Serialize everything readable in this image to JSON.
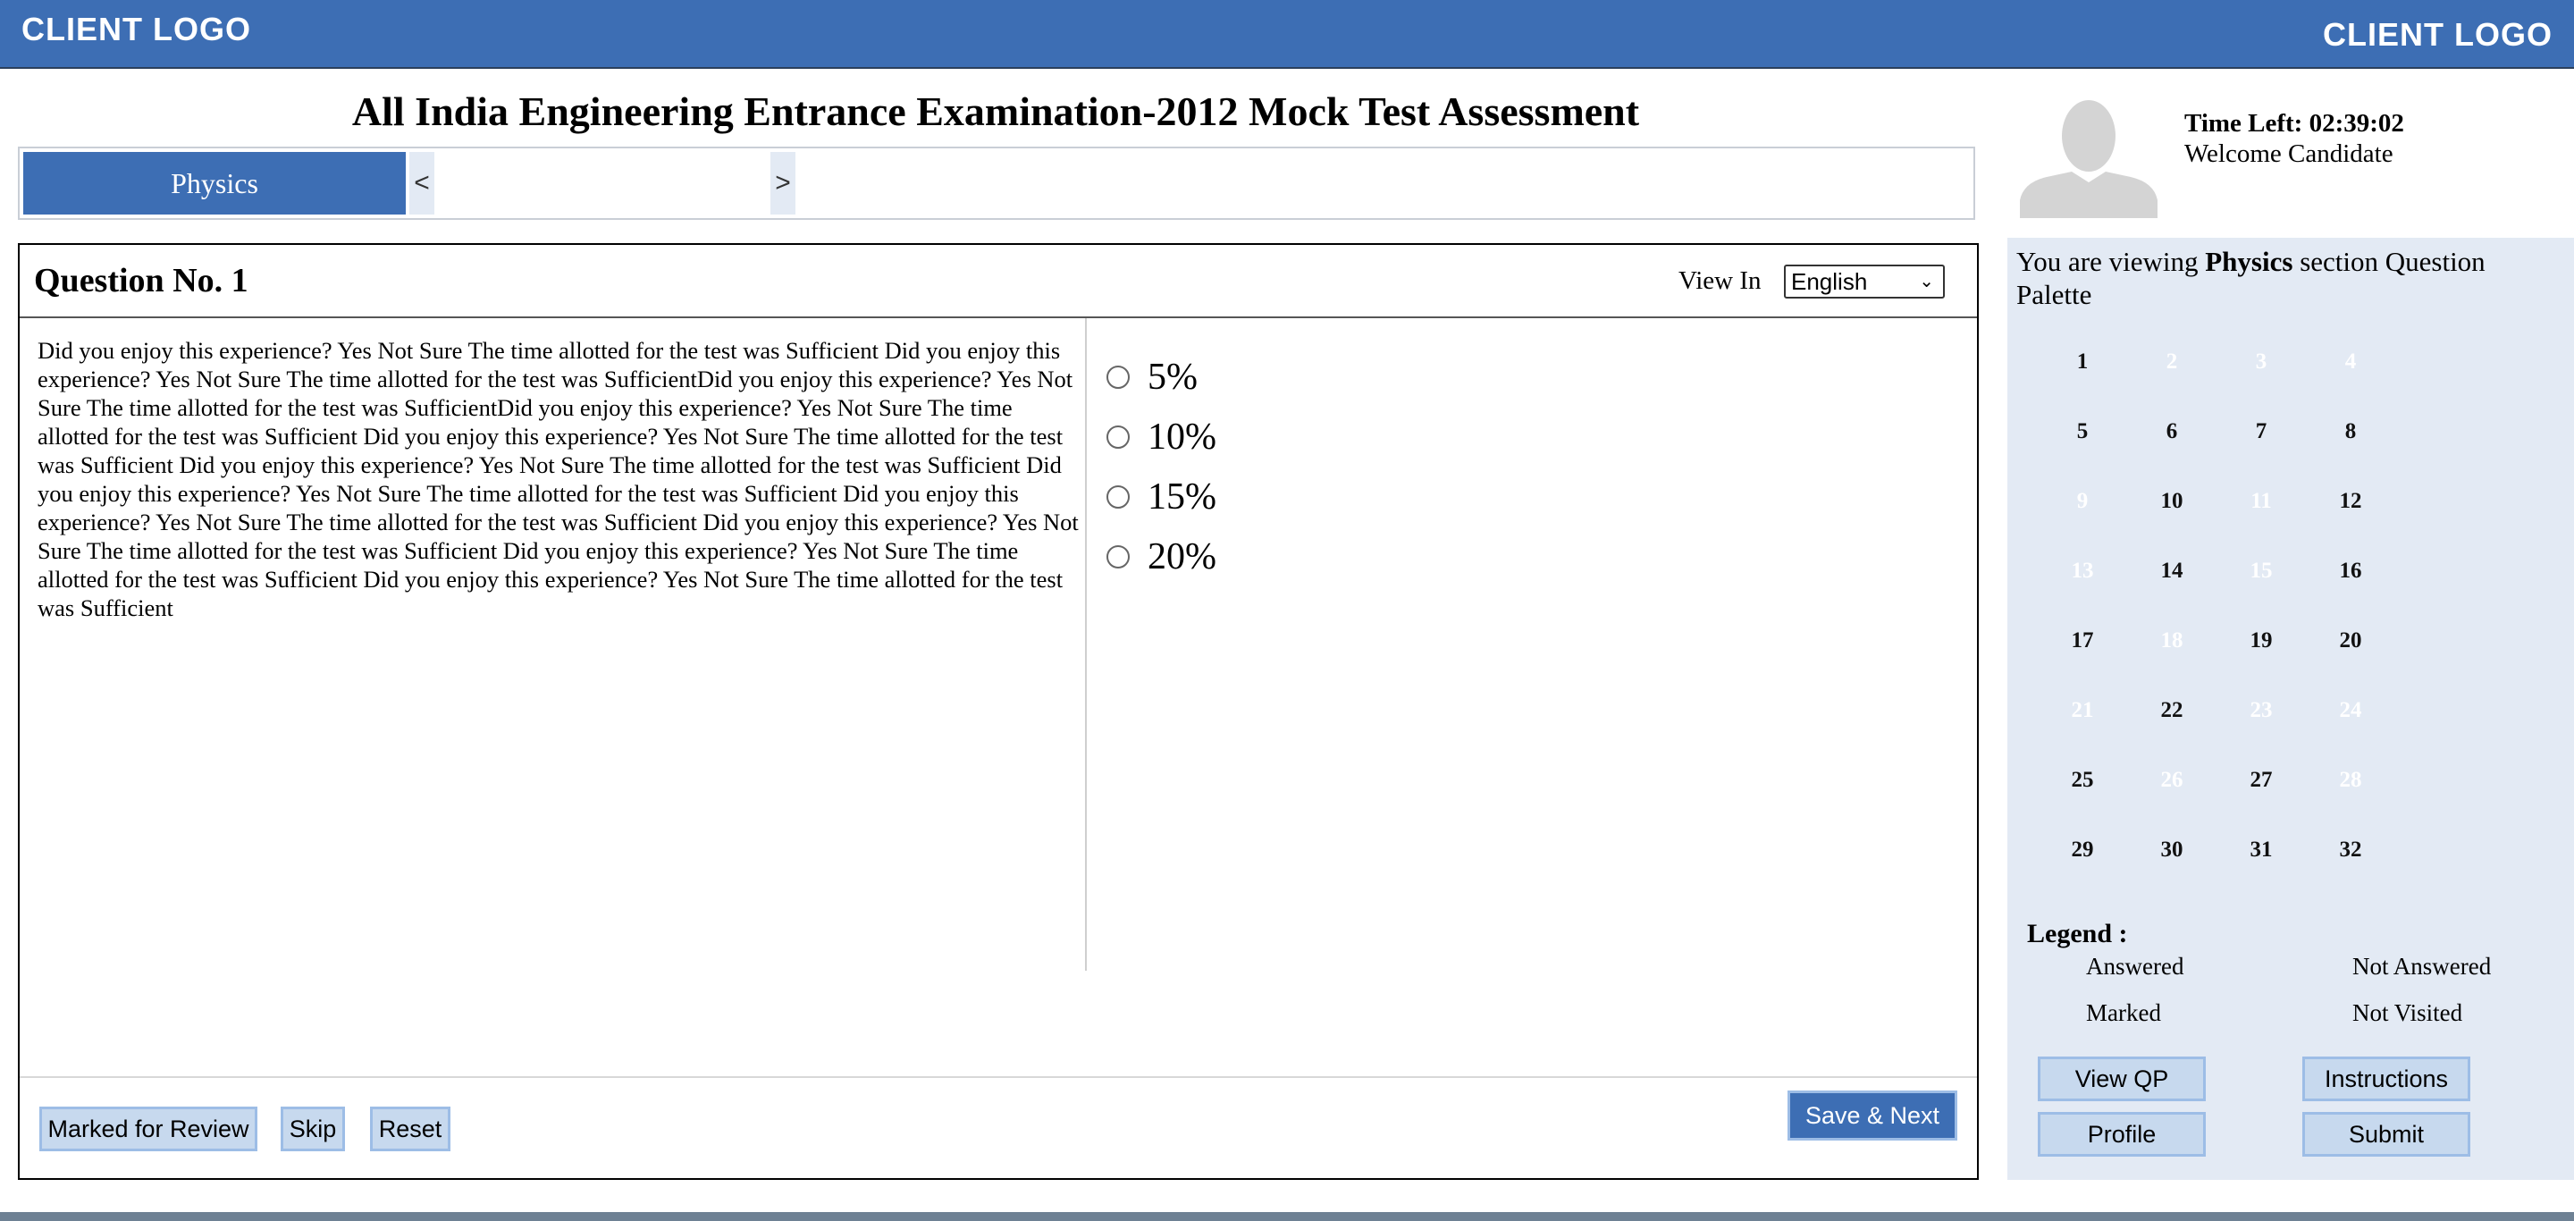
{
  "header": {
    "left_logo": "CLIENT LOGO",
    "right_logo": "CLIENT LOGO",
    "bar_color": "#3d6eb4"
  },
  "exam": {
    "title": "All India Engineering Entrance Examination-2012 Mock Test Assessment"
  },
  "sections": {
    "active": "Physics",
    "prev_arrow": "<",
    "next_arrow": ">"
  },
  "question": {
    "number_label": "Question No. 1",
    "view_in_label": "View In",
    "language": "English",
    "text": "Did you enjoy this experience? Yes Not Sure The time allotted for the test was Sufficient Did you enjoy this experience? Yes Not Sure The time allotted for the test was SufficientDid you enjoy this experience? Yes Not Sure The time allotted for the test was SufficientDid you enjoy this experience? Yes Not Sure The time allotted for the test was Sufficient Did you enjoy this experience? Yes Not Sure The time allotted for the test was Sufficient Did you enjoy this experience? Yes Not Sure The time allotted for the test was Sufficient Did you enjoy this experience? Yes Not Sure The time allotted for the test was Sufficient Did you enjoy this experience? Yes Not Sure The time allotted for the test was Sufficient Did you enjoy this experience? Yes Not Sure The time allotted for the test was Sufficient Did you enjoy this experience? Yes Not Sure The time allotted for the test was Sufficient Did you enjoy this experience? Yes Not Sure The time allotted for the test was Sufficient",
    "options": [
      "5%",
      "10%",
      "15%",
      "20%"
    ]
  },
  "actions": {
    "mark_review": "Marked for Review",
    "skip": "Skip",
    "reset": "Reset",
    "save_next": "Save & Next"
  },
  "candidate": {
    "avatar_icon": "user-silhouette-icon",
    "time_left": "Time Left: 02:39:02",
    "welcome": "Welcome Candidate"
  },
  "palette": {
    "title_prefix": "You are viewing",
    "section": "Physics",
    "title_suffix": "section Question Palette",
    "questions": [
      {
        "n": "1",
        "visited": true
      },
      {
        "n": "2",
        "visited": false
      },
      {
        "n": "3",
        "visited": false
      },
      {
        "n": "4",
        "visited": false
      },
      {
        "n": "5",
        "visited": true
      },
      {
        "n": "6",
        "visited": true
      },
      {
        "n": "7",
        "visited": true
      },
      {
        "n": "8",
        "visited": true
      },
      {
        "n": "9",
        "visited": false
      },
      {
        "n": "10",
        "visited": true
      },
      {
        "n": "11",
        "visited": false
      },
      {
        "n": "12",
        "visited": true
      },
      {
        "n": "13",
        "visited": false
      },
      {
        "n": "14",
        "visited": true
      },
      {
        "n": "15",
        "visited": false
      },
      {
        "n": "16",
        "visited": true
      },
      {
        "n": "17",
        "visited": true
      },
      {
        "n": "18",
        "visited": false
      },
      {
        "n": "19",
        "visited": true
      },
      {
        "n": "20",
        "visited": true
      },
      {
        "n": "21",
        "visited": false
      },
      {
        "n": "22",
        "visited": true
      },
      {
        "n": "23",
        "visited": false
      },
      {
        "n": "24",
        "visited": false
      },
      {
        "n": "25",
        "visited": true
      },
      {
        "n": "26",
        "visited": false
      },
      {
        "n": "27",
        "visited": true
      },
      {
        "n": "28",
        "visited": false
      },
      {
        "n": "29",
        "visited": true
      },
      {
        "n": "30",
        "visited": true
      },
      {
        "n": "31",
        "visited": true
      },
      {
        "n": "32",
        "visited": true
      }
    ]
  },
  "legend": {
    "title": "Legend :",
    "answered": "Answered",
    "not_answered": "Not Answered",
    "marked": "Marked",
    "not_visited": "Not Visited"
  },
  "panel_buttons": {
    "view_qp": "View QP",
    "instructions": "Instructions",
    "profile": "Profile",
    "submit": "Submit"
  }
}
